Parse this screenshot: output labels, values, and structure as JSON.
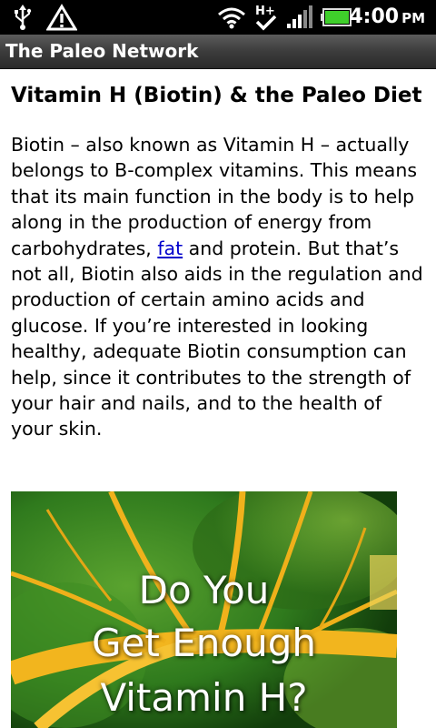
{
  "status_bar": {
    "time": "4:00",
    "ampm": "PM",
    "icons": [
      "usb-icon",
      "warning-icon",
      "wifi-icon",
      "hplus-data-icon",
      "signal-icon",
      "battery-icon"
    ]
  },
  "app": {
    "title": "The Paleo Network"
  },
  "article": {
    "title": "Vitamin H (Biotin) & the Paleo Diet",
    "body_before_link": "Biotin – also known as Vitamin H – actually belongs to B-complex vitamins. This means that its main function in the body is to help along in the production of energy from carbohydrates, ",
    "link_text": "fat",
    "body_after_link": " and protein. But that’s not all, Biotin also aids in the regulation and production of certain amino acids and glucose. If you’re interested in looking healthy, adequate Biotin consumption can help, since it contributes to the strength of your hair and nails, and to the health of your skin."
  },
  "image": {
    "line1": "Do You",
    "line2": "Get Enough",
    "line3": "Vitamin H?"
  },
  "colors": {
    "status_bar_bg": "#000000",
    "link": "#0000cc",
    "leaf_green": "#2f6b1e",
    "stem_yellow": "#f2b51e"
  }
}
